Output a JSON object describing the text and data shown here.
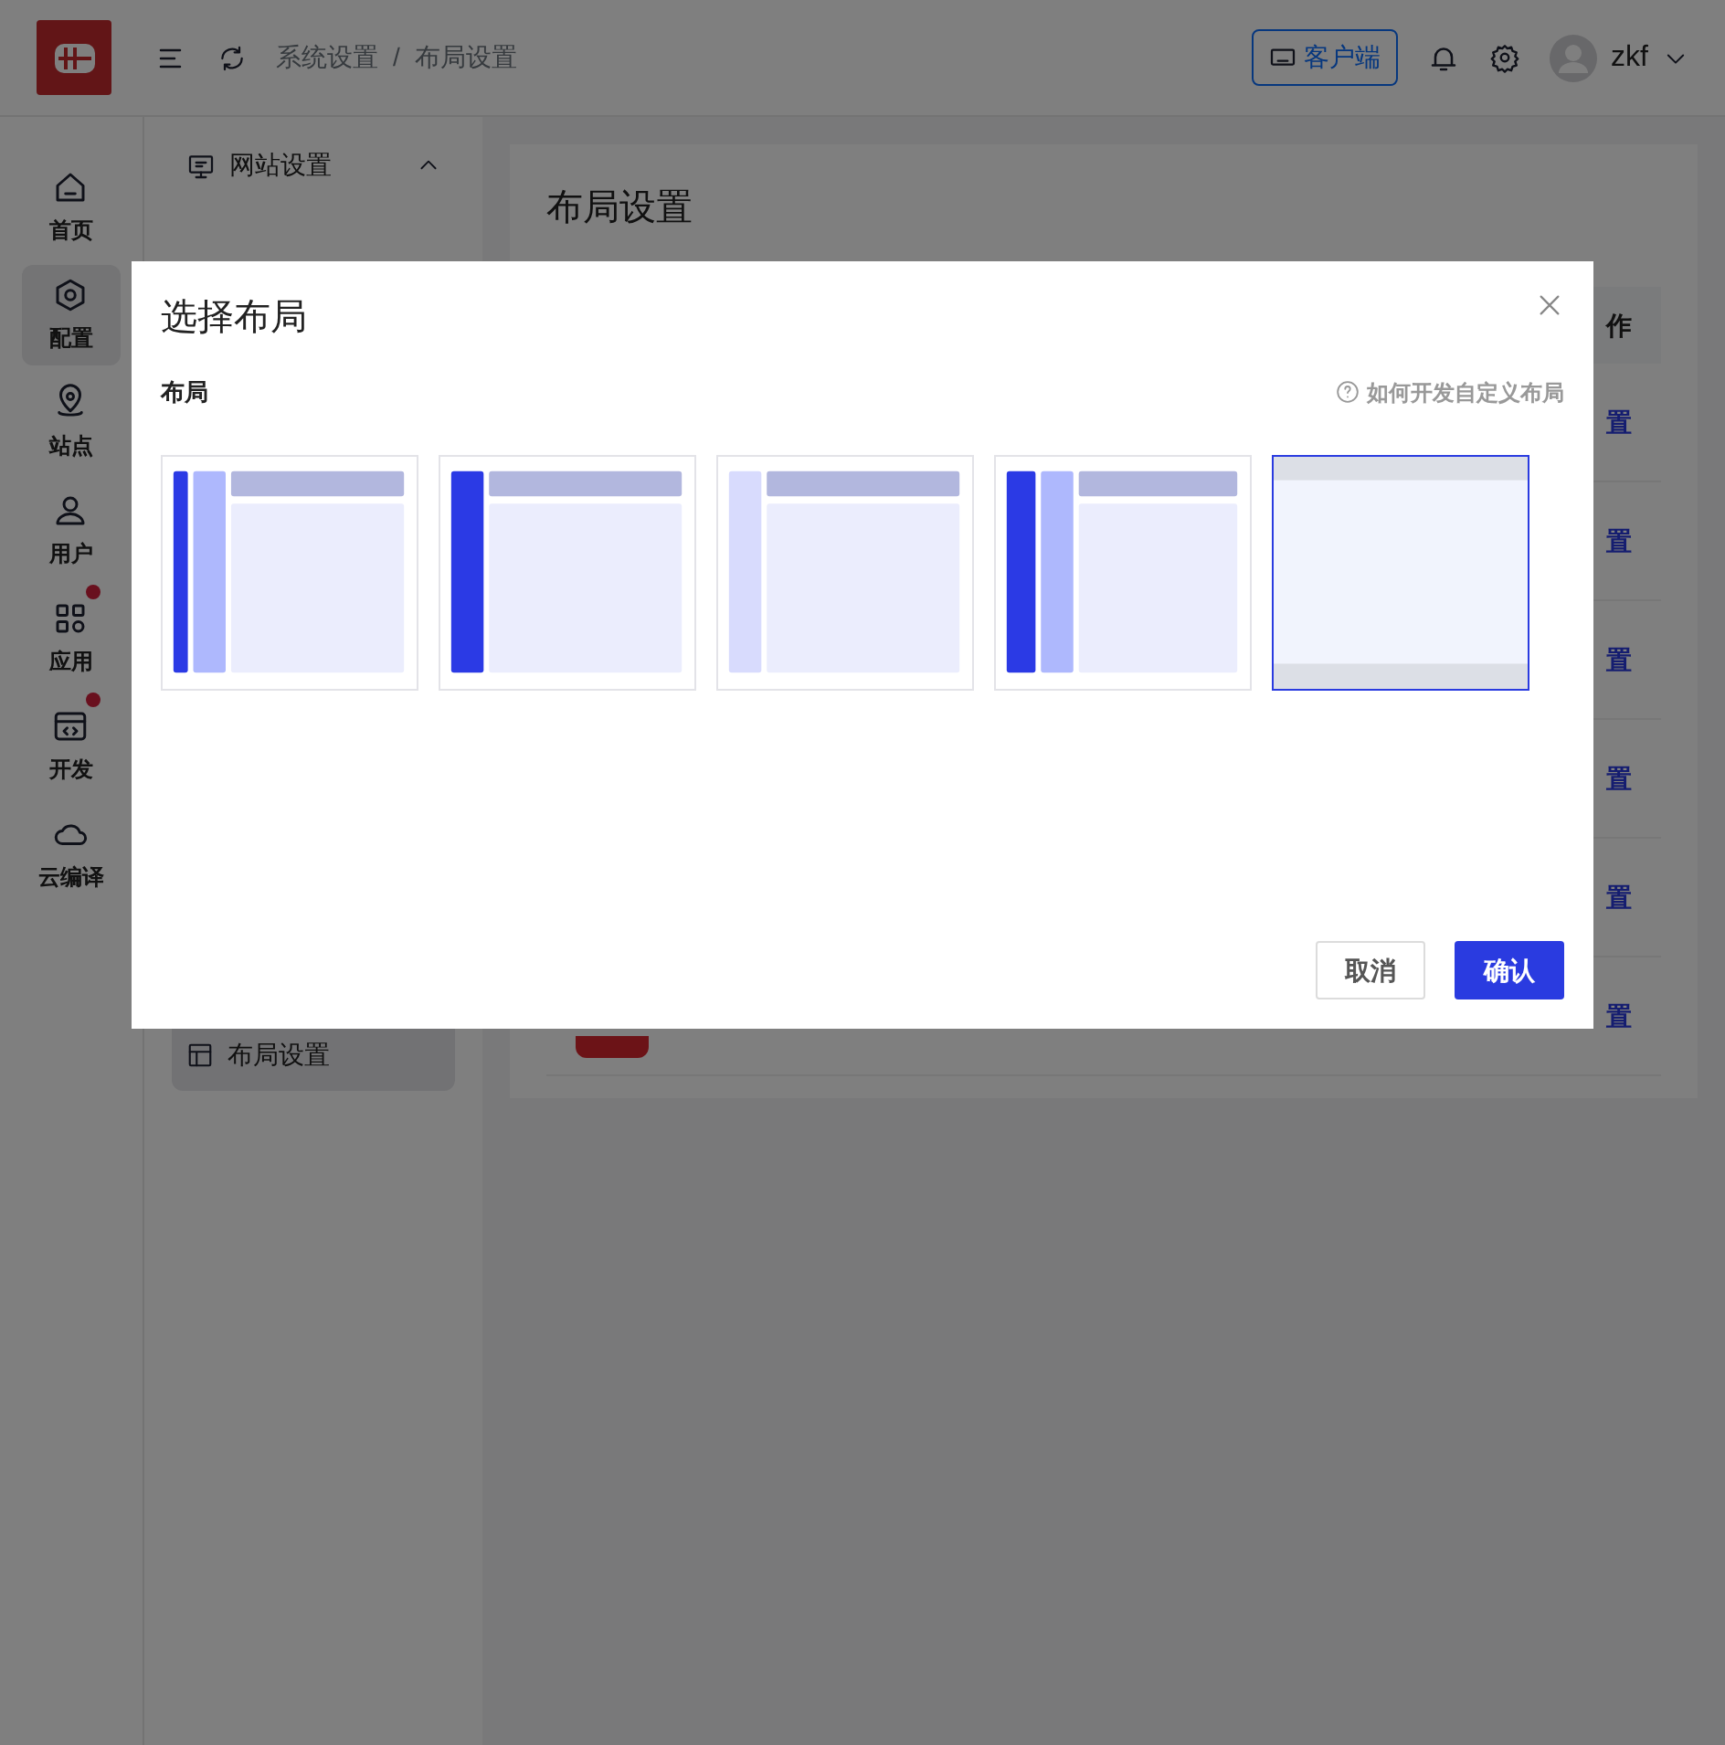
{
  "header": {
    "breadcrumb": [
      "系统设置",
      "布局设置"
    ],
    "separator": "/",
    "client_button": "客户端",
    "user": "zkf"
  },
  "rail": [
    {
      "label": "首页",
      "selected": false,
      "notice": false
    },
    {
      "label": "配置",
      "selected": true,
      "notice": false
    },
    {
      "label": "站点",
      "selected": false,
      "notice": false
    },
    {
      "label": "用户",
      "selected": false,
      "notice": false
    },
    {
      "label": "应用",
      "selected": false,
      "notice": true
    },
    {
      "label": "开发",
      "selected": false,
      "notice": true
    },
    {
      "label": "云编译",
      "selected": false,
      "notice": false
    }
  ],
  "sidebar": {
    "group": {
      "label": "网站设置",
      "expanded": true
    },
    "items": [
      {
        "label": "布局设置",
        "selected": true
      }
    ]
  },
  "card": {
    "title": "布局设置",
    "column_header": "作",
    "rows": [
      {
        "action": "置"
      },
      {
        "action": "置"
      },
      {
        "action": "置"
      },
      {
        "action": "置"
      },
      {
        "action": "置"
      },
      {
        "action": "置",
        "status_tag": true
      }
    ]
  },
  "modal": {
    "title": "选择布局",
    "field_label": "布局",
    "help_link": "如何开发自定义布局",
    "layouts": [
      {
        "kind": "dual-sidebar",
        "selected": false
      },
      {
        "kind": "wide-sidebar",
        "selected": false
      },
      {
        "kind": "light-sidebar",
        "selected": false
      },
      {
        "kind": "dual-wide-sidebar",
        "selected": false
      },
      {
        "kind": "top-bottom",
        "selected": true
      }
    ],
    "buttons": [
      {
        "label": "取消",
        "kind": "secondary"
      },
      {
        "label": "确认",
        "kind": "primary"
      }
    ]
  }
}
